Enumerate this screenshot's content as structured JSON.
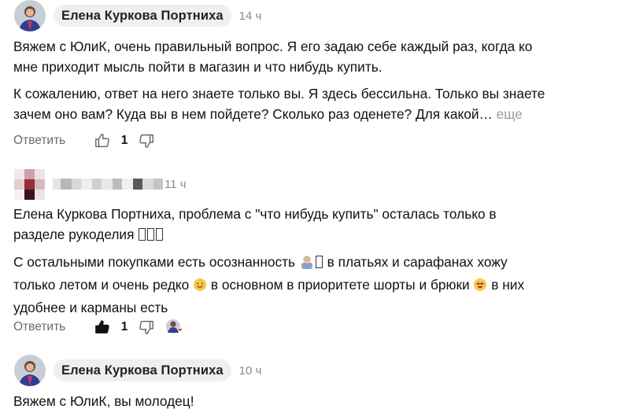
{
  "comments": [
    {
      "author": "Елена Куркова Портниха",
      "time": "14 ч",
      "paragraphs": [
        "Вяжем с ЮлиК, очень правильный вопрос. Я его задаю себе каждый раз, когда ко",
        "мне приходит мысль пойти в магазин и что нибудь купить.",
        "К сожалению, ответ на него знаете только вы. Я здесь бессильна. Только вы знаете",
        "зачем оно вам? Куда вы в нем пойдете? Сколько раз оденете? Для какой…"
      ],
      "more_label": "еще",
      "reply_label": "Ответить",
      "likes": "1"
    },
    {
      "author": "",
      "time": "11 ч",
      "p1_line1": "Елена Куркова Портниха, проблема с \"что нибудь купить\" осталась только в",
      "p1_line2": "разделе рукоделия",
      "p2_line1a": "С остальными покупками есть осознанность",
      "p2_line1b": " в платьях и сарафанах хожу",
      "p2_line2a": "только летом и очень редко",
      "p2_line2b": " в основном в приоритете шорты и брюки",
      "p2_line2c": " в них",
      "p2_line3": "удобнее и карманы есть",
      "reply_label": "Ответить",
      "likes": "1"
    },
    {
      "author": "Елена Куркова Портниха",
      "time": "10 ч",
      "text": "Вяжем с ЮлиК, вы молодец!"
    }
  ],
  "icons": [
    "thumb-up-icon",
    "thumb-down-icon",
    "author-heart-reaction-icon"
  ],
  "colors": {
    "pill_bg": "#eeeff1",
    "muted": "#8a8a8a",
    "text": "#111111",
    "heart": "#e8453c"
  }
}
